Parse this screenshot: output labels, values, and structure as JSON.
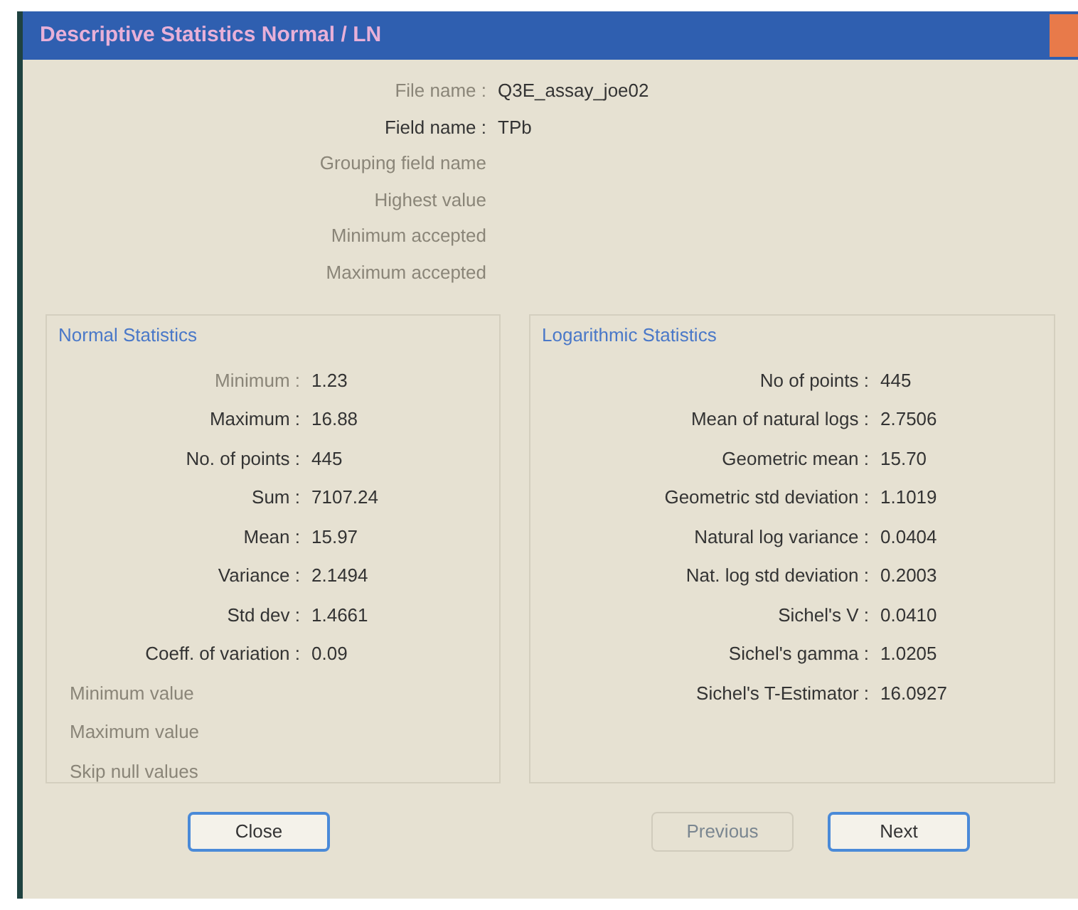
{
  "window": {
    "title": "Descriptive Statistics Normal / LN"
  },
  "header_fields": [
    {
      "label": "File name :",
      "value": "Q3E_assay_joe02",
      "disabled": true
    },
    {
      "label": "Field name :",
      "value": "TPb",
      "disabled": false
    },
    {
      "label": "Grouping field name",
      "disabled": true
    },
    {
      "label": "Highest value",
      "disabled": true
    },
    {
      "label": "Minimum accepted",
      "disabled": true
    },
    {
      "label": "Maximum accepted",
      "disabled": true
    }
  ],
  "normal_statistics": {
    "title": "Normal Statistics",
    "rows": [
      {
        "label": "Minimum :",
        "value": "1.23",
        "disabled": true
      },
      {
        "label": "Maximum :",
        "value": "16.88",
        "disabled": false
      },
      {
        "label": "No. of points :",
        "value": "445",
        "disabled": false
      },
      {
        "label": "Sum :",
        "value": "7107.24",
        "disabled": false
      },
      {
        "label": "Mean :",
        "value": "15.97",
        "disabled": false
      },
      {
        "label": "Variance :",
        "value": "2.1494",
        "disabled": false
      },
      {
        "label": "Std dev :",
        "value": "1.4661",
        "disabled": false
      },
      {
        "label": "Coeff. of variation :",
        "value": "0.09",
        "disabled": false
      }
    ],
    "notes": [
      "Minimum value",
      "Maximum value",
      "Skip null values"
    ]
  },
  "logarithmic_statistics": {
    "title": "Logarithmic Statistics",
    "rows": [
      {
        "label": "No of points :",
        "value": "445"
      },
      {
        "label": "Mean of natural logs :",
        "value": "2.7506"
      },
      {
        "label": "Geometric mean :",
        "value": "15.70"
      },
      {
        "label": "Geometric std deviation :",
        "value": "1.1019"
      },
      {
        "label": "Natural log variance :",
        "value": "0.0404"
      },
      {
        "label": "Nat. log std deviation :",
        "value": "0.2003"
      },
      {
        "label": "Sichel's V :",
        "value": "0.0410"
      },
      {
        "label": "Sichel's gamma :",
        "value": "1.0205"
      },
      {
        "label": "Sichel's T-Estimator :",
        "value": "16.0927"
      }
    ]
  },
  "buttons": [
    {
      "label": "Close",
      "disabled": false
    },
    {
      "label": "Previous",
      "disabled": true
    },
    {
      "label": "Next",
      "disabled": false
    }
  ]
}
